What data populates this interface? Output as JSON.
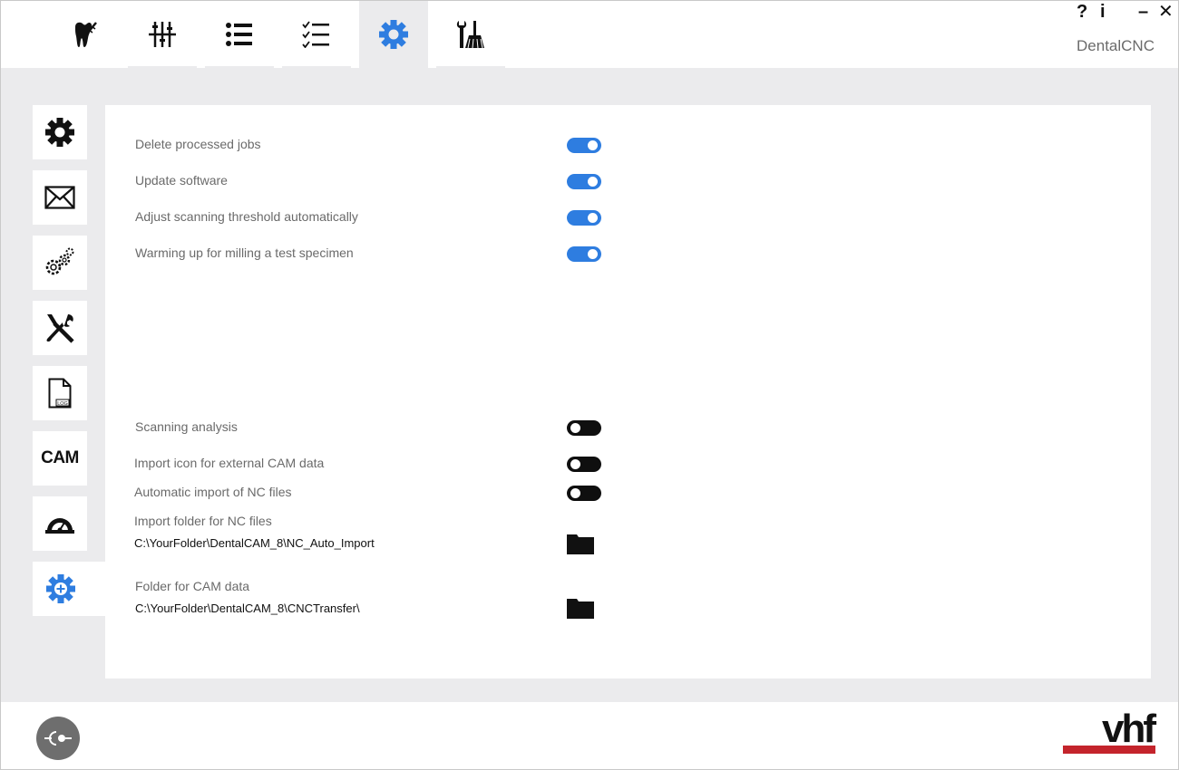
{
  "app": {
    "title": "DentalCNC",
    "help_label": "?",
    "info_label": "i",
    "minimize_label": "–",
    "close_label": "✕"
  },
  "top_tabs": [
    {
      "icon": "tooth-icon"
    },
    {
      "icon": "sliders-icon"
    },
    {
      "icon": "list-icon"
    },
    {
      "icon": "checklist-icon"
    },
    {
      "icon": "gear-icon",
      "active": true
    },
    {
      "icon": "tools-broom-icon"
    }
  ],
  "sidebar": {
    "items": [
      {
        "icon": "gear-icon"
      },
      {
        "icon": "envelope-icon"
      },
      {
        "icon": "gears-icon"
      },
      {
        "icon": "wrench-screwdriver-icon"
      },
      {
        "icon": "log-file-icon",
        "log_label": "LOG"
      },
      {
        "icon": "cam-icon",
        "label": "CAM"
      },
      {
        "icon": "gauge-icon"
      },
      {
        "icon": "gear-plus-icon",
        "active": true
      }
    ]
  },
  "settings": {
    "toggles_top": [
      {
        "label": "Delete processed jobs",
        "on": true
      },
      {
        "label": "Update software",
        "on": true
      },
      {
        "label": "Adjust scanning threshold automatically",
        "on": true
      },
      {
        "label": "Warming up for milling a test specimen",
        "on": true
      }
    ],
    "toggles_bottom": [
      {
        "label": "Scanning analysis",
        "on": false
      },
      {
        "label": "Import icon for external CAM data",
        "on": false
      },
      {
        "label": "Automatic import of NC files",
        "on": false
      }
    ],
    "folders": [
      {
        "label": "Import folder for NC files",
        "path": "C:\\YourFolder\\DentalCAM_8\\NC_Auto_Import"
      },
      {
        "label": "Folder for CAM data",
        "path": "C:\\YourFolder\\DentalCAM_8\\CNCTransfer\\"
      }
    ]
  },
  "footer": {
    "logo_text": "vhf"
  },
  "colors": {
    "accent": "#2e7de0",
    "toggle_off": "#0f0f0f",
    "background": "#ebebed",
    "logo_red": "#c4242c"
  }
}
